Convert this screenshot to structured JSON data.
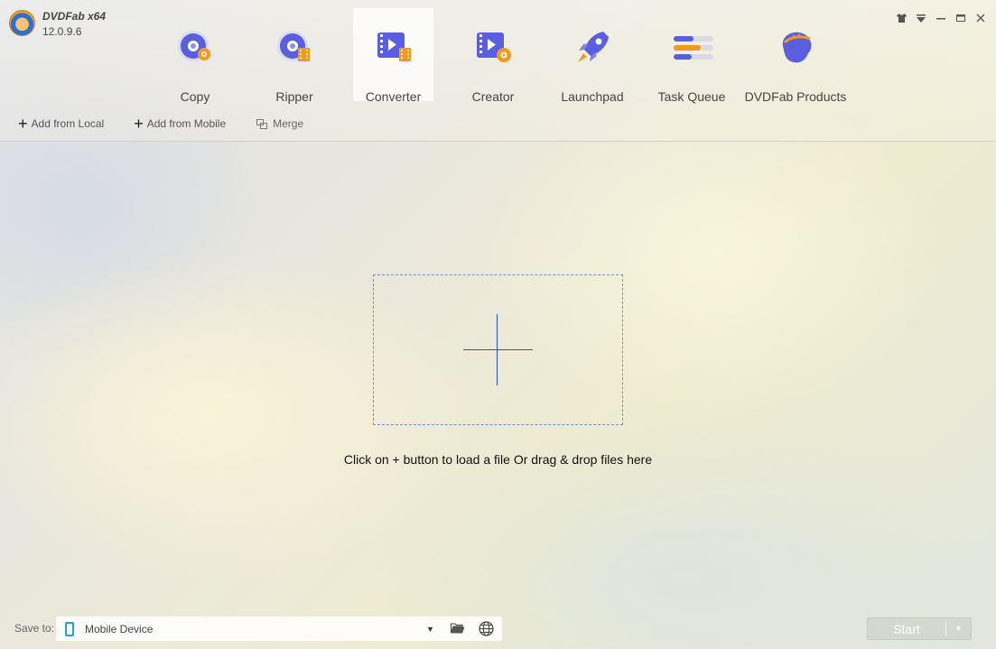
{
  "app": {
    "title": "DVDFab x64",
    "version": "12.0.9.6"
  },
  "nav": [
    {
      "label": "Copy",
      "icon": "copy-disc-icon"
    },
    {
      "label": "Ripper",
      "icon": "ripper-disc-icon"
    },
    {
      "label": "Converter",
      "icon": "converter-film-icon",
      "active": true
    },
    {
      "label": "Creator",
      "icon": "creator-film-icon"
    },
    {
      "label": "Launchpad",
      "icon": "rocket-icon"
    },
    {
      "label": "Task Queue",
      "icon": "task-queue-icon"
    },
    {
      "label": "DVDFab Products",
      "icon": "dvdfab-products-icon"
    }
  ],
  "window_controls": [
    "skin-icon",
    "menu-dropdown-icon",
    "minimize-icon",
    "maximize-icon",
    "close-icon"
  ],
  "toolbar": {
    "add_local": "Add from Local",
    "add_mobile": "Add from Mobile",
    "merge": "Merge"
  },
  "dropzone": {
    "hint": "Click on + button to load a file Or drag & drop files here"
  },
  "bottom": {
    "save_to_label": "Save to:",
    "save_to_value": "Mobile Device",
    "start_label": "Start"
  },
  "colors": {
    "accent_blue": "#2a54c4",
    "disc_purple": "#5a5ee0",
    "orange": "#f39a1e",
    "device_blue": "#1ea0e8"
  }
}
